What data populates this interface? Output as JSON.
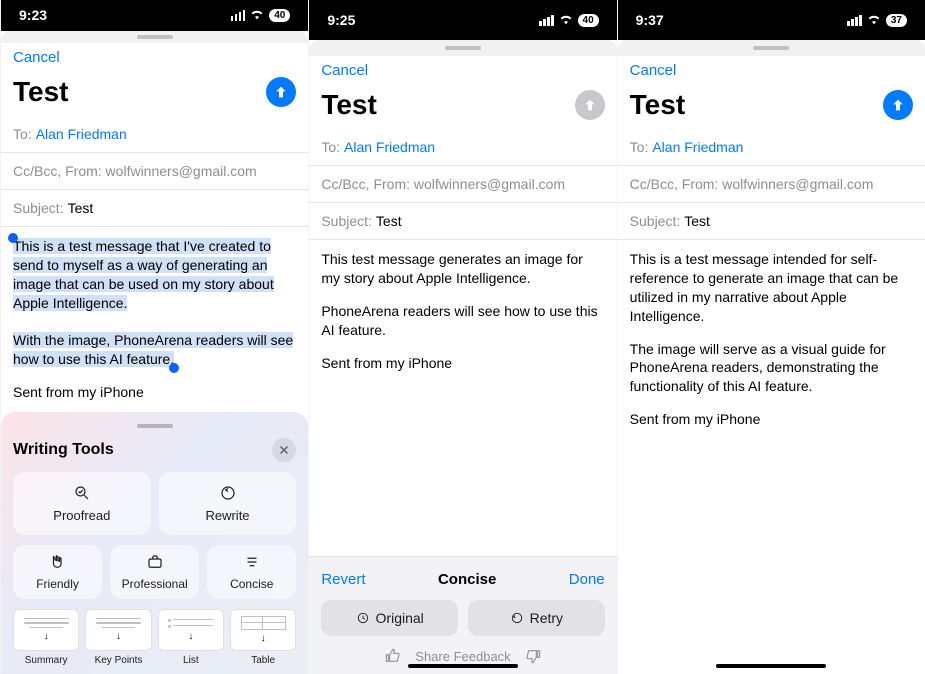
{
  "phones": [
    {
      "time": "9:23",
      "battery": "40",
      "cancel": "Cancel",
      "title": "Test",
      "send_active": true,
      "to_label": "To:",
      "to_value": "Alan Friedman",
      "ccbcc": "Cc/Bcc, From:  wolfwinners@gmail.com",
      "subject_label": "Subject:",
      "subject_value": "Test",
      "body_p1": "This is a test message that I've created to send to myself as a way of generating an image that can be used on my story about Apple Intelligence.",
      "body_p2": "With the image, PhoneArena readers will see how to use this AI feature.",
      "signature": "Sent from my iPhone",
      "writing_tools": {
        "title": "Writing Tools",
        "proofread": "Proofread",
        "rewrite": "Rewrite",
        "friendly": "Friendly",
        "professional": "Professional",
        "concise": "Concise",
        "summary": "Summary",
        "keypoints": "Key Points",
        "list": "List",
        "table": "Table"
      }
    },
    {
      "time": "9:25",
      "battery": "40",
      "cancel": "Cancel",
      "title": "Test",
      "send_active": false,
      "to_label": "To:",
      "to_value": "Alan Friedman",
      "ccbcc": "Cc/Bcc, From:  wolfwinners@gmail.com",
      "subject_label": "Subject:",
      "subject_value": "Test",
      "body_p1": "This test message generates an image for my story about Apple Intelligence.",
      "body_p2": "PhoneArena readers will see how to use this AI feature.",
      "signature": "Sent from my iPhone",
      "concise_panel": {
        "revert": "Revert",
        "title": "Concise",
        "done": "Done",
        "original": "Original",
        "retry": "Retry",
        "share": "Share Feedback"
      }
    },
    {
      "time": "9:37",
      "battery": "37",
      "cancel": "Cancel",
      "title": "Test",
      "send_active": true,
      "to_label": "To:",
      "to_value": "Alan Friedman",
      "ccbcc": "Cc/Bcc, From:  wolfwinners@gmail.com",
      "subject_label": "Subject:",
      "subject_value": "Test",
      "body_p1": "This is a test message intended for self-reference to generate an image that can be utilized in my narrative about Apple Intelligence.",
      "body_p2": "The image will serve as a visual guide for PhoneArena readers, demonstrating the functionality of this AI feature.",
      "signature": "Sent from my iPhone"
    }
  ]
}
